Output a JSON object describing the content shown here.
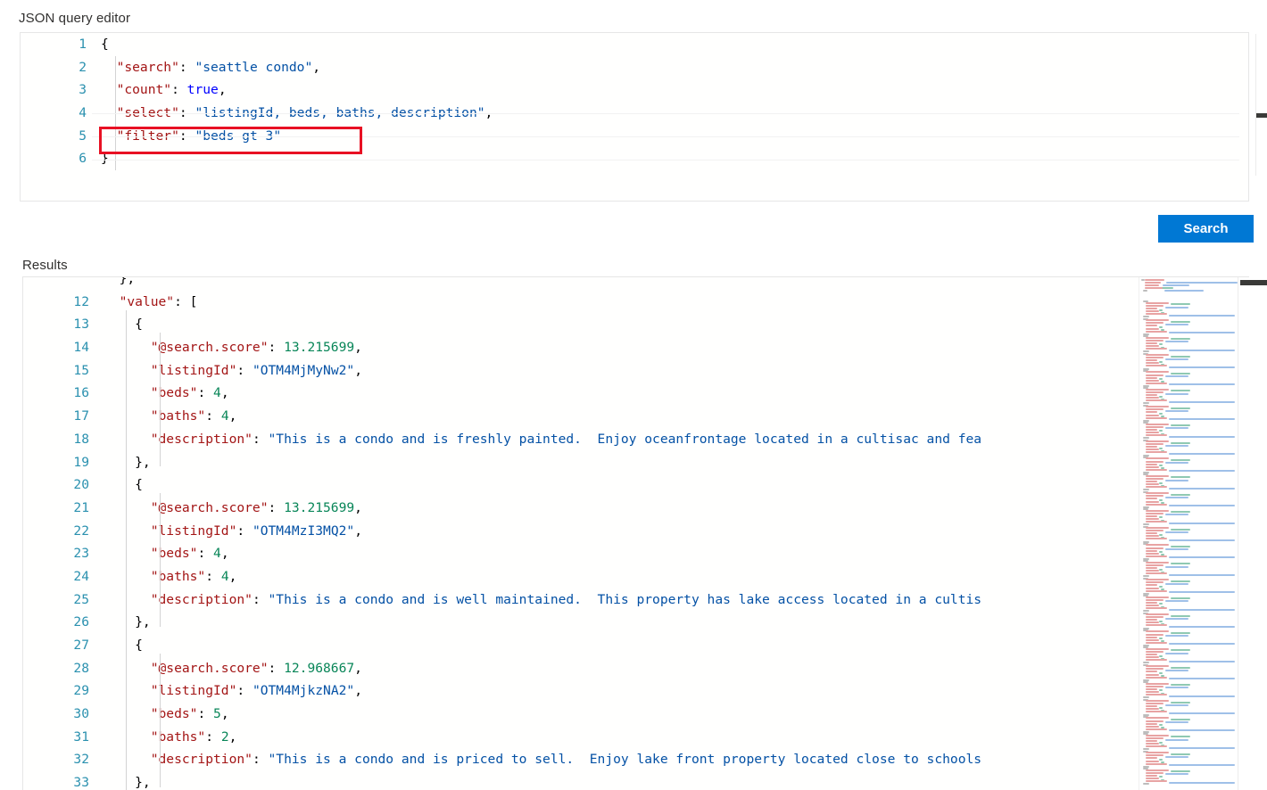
{
  "sections": {
    "query_editor_label": "JSON query editor",
    "results_label": "Results"
  },
  "actions": {
    "search_label": "Search"
  },
  "colors": {
    "accent": "#0078d4",
    "annotation": "#e81123",
    "key": "#a31515",
    "string": "#0451a5",
    "number": "#098658",
    "boolean": "#0000ff",
    "line_number": "#2b91af"
  },
  "query_editor": {
    "highlighted_line": 5,
    "lines": [
      {
        "n": "1",
        "tokens": [
          {
            "t": "{",
            "c": "punct"
          }
        ]
      },
      {
        "n": "2",
        "tokens": [
          {
            "t": "  \"search\"",
            "c": "key"
          },
          {
            "t": ": ",
            "c": "punct"
          },
          {
            "t": "\"seattle condo\"",
            "c": "string"
          },
          {
            "t": ",",
            "c": "punct"
          }
        ]
      },
      {
        "n": "3",
        "tokens": [
          {
            "t": "  \"count\"",
            "c": "key"
          },
          {
            "t": ": ",
            "c": "punct"
          },
          {
            "t": "true",
            "c": "bool"
          },
          {
            "t": ",",
            "c": "punct"
          }
        ]
      },
      {
        "n": "4",
        "tokens": [
          {
            "t": "  \"select\"",
            "c": "key"
          },
          {
            "t": ": ",
            "c": "punct"
          },
          {
            "t": "\"listingId, beds, baths, description\"",
            "c": "string"
          },
          {
            "t": ",",
            "c": "punct"
          }
        ]
      },
      {
        "n": "5",
        "tokens": [
          {
            "t": "  \"filter\"",
            "c": "key"
          },
          {
            "t": ": ",
            "c": "punct"
          },
          {
            "t": "\"beds gt 3\"",
            "c": "string"
          }
        ]
      },
      {
        "n": "6",
        "tokens": [
          {
            "t": "}",
            "c": "punct"
          }
        ]
      }
    ]
  },
  "results": {
    "clipped_top_line": "},",
    "lines": [
      {
        "n": "12",
        "tokens": [
          {
            "t": "  \"value\"",
            "c": "key"
          },
          {
            "t": ": [",
            "c": "punct"
          }
        ]
      },
      {
        "n": "13",
        "tokens": [
          {
            "t": "    {",
            "c": "punct"
          }
        ]
      },
      {
        "n": "14",
        "tokens": [
          {
            "t": "      \"@search.score\"",
            "c": "key"
          },
          {
            "t": ": ",
            "c": "punct"
          },
          {
            "t": "13.215699",
            "c": "number"
          },
          {
            "t": ",",
            "c": "punct"
          }
        ]
      },
      {
        "n": "15",
        "tokens": [
          {
            "t": "      \"listingId\"",
            "c": "key"
          },
          {
            "t": ": ",
            "c": "punct"
          },
          {
            "t": "\"OTM4MjMyNw2\"",
            "c": "string"
          },
          {
            "t": ",",
            "c": "punct"
          }
        ]
      },
      {
        "n": "16",
        "tokens": [
          {
            "t": "      \"beds\"",
            "c": "key"
          },
          {
            "t": ": ",
            "c": "punct"
          },
          {
            "t": "4",
            "c": "number"
          },
          {
            "t": ",",
            "c": "punct"
          }
        ]
      },
      {
        "n": "17",
        "tokens": [
          {
            "t": "      \"baths\"",
            "c": "key"
          },
          {
            "t": ": ",
            "c": "punct"
          },
          {
            "t": "4",
            "c": "number"
          },
          {
            "t": ",",
            "c": "punct"
          }
        ]
      },
      {
        "n": "18",
        "tokens": [
          {
            "t": "      \"description\"",
            "c": "key"
          },
          {
            "t": ": ",
            "c": "punct"
          },
          {
            "t": "\"This is a condo and is freshly painted.  Enjoy oceanfrontage located in a cultisac and fea",
            "c": "string"
          }
        ]
      },
      {
        "n": "19",
        "tokens": [
          {
            "t": "    },",
            "c": "punct"
          }
        ]
      },
      {
        "n": "20",
        "tokens": [
          {
            "t": "    {",
            "c": "punct"
          }
        ]
      },
      {
        "n": "21",
        "tokens": [
          {
            "t": "      \"@search.score\"",
            "c": "key"
          },
          {
            "t": ": ",
            "c": "punct"
          },
          {
            "t": "13.215699",
            "c": "number"
          },
          {
            "t": ",",
            "c": "punct"
          }
        ]
      },
      {
        "n": "22",
        "tokens": [
          {
            "t": "      \"listingId\"",
            "c": "key"
          },
          {
            "t": ": ",
            "c": "punct"
          },
          {
            "t": "\"OTM4MzI3MQ2\"",
            "c": "string"
          },
          {
            "t": ",",
            "c": "punct"
          }
        ]
      },
      {
        "n": "23",
        "tokens": [
          {
            "t": "      \"beds\"",
            "c": "key"
          },
          {
            "t": ": ",
            "c": "punct"
          },
          {
            "t": "4",
            "c": "number"
          },
          {
            "t": ",",
            "c": "punct"
          }
        ]
      },
      {
        "n": "24",
        "tokens": [
          {
            "t": "      \"baths\"",
            "c": "key"
          },
          {
            "t": ": ",
            "c": "punct"
          },
          {
            "t": "4",
            "c": "number"
          },
          {
            "t": ",",
            "c": "punct"
          }
        ]
      },
      {
        "n": "25",
        "tokens": [
          {
            "t": "      \"description\"",
            "c": "key"
          },
          {
            "t": ": ",
            "c": "punct"
          },
          {
            "t": "\"This is a condo and is well maintained.  This property has lake access located in a cultis",
            "c": "string"
          }
        ]
      },
      {
        "n": "26",
        "tokens": [
          {
            "t": "    },",
            "c": "punct"
          }
        ]
      },
      {
        "n": "27",
        "tokens": [
          {
            "t": "    {",
            "c": "punct"
          }
        ]
      },
      {
        "n": "28",
        "tokens": [
          {
            "t": "      \"@search.score\"",
            "c": "key"
          },
          {
            "t": ": ",
            "c": "punct"
          },
          {
            "t": "12.968667",
            "c": "number"
          },
          {
            "t": ",",
            "c": "punct"
          }
        ]
      },
      {
        "n": "29",
        "tokens": [
          {
            "t": "      \"listingId\"",
            "c": "key"
          },
          {
            "t": ": ",
            "c": "punct"
          },
          {
            "t": "\"OTM4MjkzNA2\"",
            "c": "string"
          },
          {
            "t": ",",
            "c": "punct"
          }
        ]
      },
      {
        "n": "30",
        "tokens": [
          {
            "t": "      \"beds\"",
            "c": "key"
          },
          {
            "t": ": ",
            "c": "punct"
          },
          {
            "t": "5",
            "c": "number"
          },
          {
            "t": ",",
            "c": "punct"
          }
        ]
      },
      {
        "n": "31",
        "tokens": [
          {
            "t": "      \"baths\"",
            "c": "key"
          },
          {
            "t": ": ",
            "c": "punct"
          },
          {
            "t": "2",
            "c": "number"
          },
          {
            "t": ",",
            "c": "punct"
          }
        ]
      },
      {
        "n": "32",
        "tokens": [
          {
            "t": "      \"description\"",
            "c": "key"
          },
          {
            "t": ": ",
            "c": "punct"
          },
          {
            "t": "\"This is a condo and is priced to sell.  Enjoy lake front property located close to schools",
            "c": "string"
          }
        ]
      },
      {
        "n": "33",
        "tokens": [
          {
            "t": "    },",
            "c": "punct"
          }
        ]
      }
    ]
  }
}
